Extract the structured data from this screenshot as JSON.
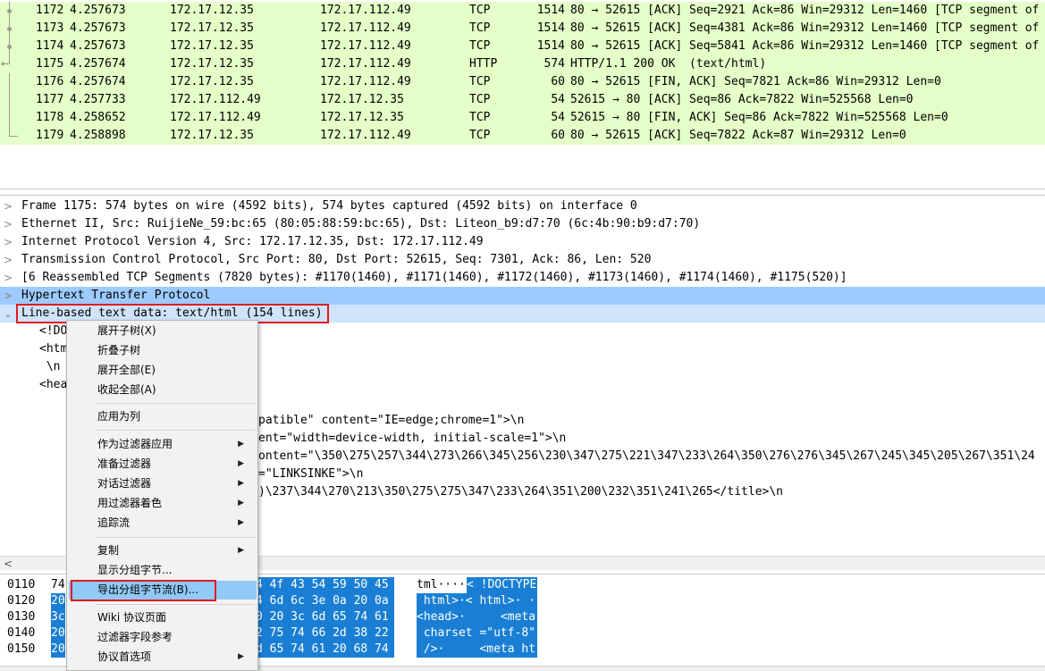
{
  "packet_list": {
    "rows": [
      {
        "no": "1172",
        "time": "4.257673",
        "src": "172.17.12.35",
        "dst": "172.17.112.49",
        "proto": "TCP",
        "len": "1514",
        "info": "80 → 52615 [ACK] Seq=2921 Ack=86 Win=29312 Len=1460 [TCP segment of"
      },
      {
        "no": "1173",
        "time": "4.257673",
        "src": "172.17.12.35",
        "dst": "172.17.112.49",
        "proto": "TCP",
        "len": "1514",
        "info": "80 → 52615 [ACK] Seq=4381 Ack=86 Win=29312 Len=1460 [TCP segment of"
      },
      {
        "no": "1174",
        "time": "4.257673",
        "src": "172.17.12.35",
        "dst": "172.17.112.49",
        "proto": "TCP",
        "len": "1514",
        "info": "80 → 52615 [ACK] Seq=5841 Ack=86 Win=29312 Len=1460 [TCP segment of"
      },
      {
        "no": "1175",
        "time": "4.257674",
        "src": "172.17.12.35",
        "dst": "172.17.112.49",
        "proto": "HTTP",
        "len": "574",
        "info": "HTTP/1.1 200 OK  (text/html)"
      },
      {
        "no": "1176",
        "time": "4.257674",
        "src": "172.17.12.35",
        "dst": "172.17.112.49",
        "proto": "TCP",
        "len": "60",
        "info": "80 → 52615 [FIN, ACK] Seq=7821 Ack=86 Win=29312 Len=0"
      },
      {
        "no": "1177",
        "time": "4.257733",
        "src": "172.17.112.49",
        "dst": "172.17.12.35",
        "proto": "TCP",
        "len": "54",
        "info": "52615 → 80 [ACK] Seq=86 Ack=7822 Win=525568 Len=0"
      },
      {
        "no": "1178",
        "time": "4.258652",
        "src": "172.17.112.49",
        "dst": "172.17.12.35",
        "proto": "TCP",
        "len": "54",
        "info": "52615 → 80 [FIN, ACK] Seq=86 Ack=7822 Win=525568 Len=0"
      },
      {
        "no": "1179",
        "time": "4.258898",
        "src": "172.17.12.35",
        "dst": "172.17.112.49",
        "proto": "TCP",
        "len": "60",
        "info": "80 → 52615 [ACK] Seq=7822 Ack=87 Win=29312 Len=0"
      }
    ]
  },
  "details": {
    "tree": [
      {
        "expander": ">",
        "text": "Frame 1175: 574 bytes on wire (4592 bits), 574 bytes captured (4592 bits) on interface 0"
      },
      {
        "expander": ">",
        "text": "Ethernet II, Src: RuijieNe_59:bc:65 (80:05:88:59:bc:65), Dst: Liteon_b9:d7:70 (6c:4b:90:b9:d7:70)"
      },
      {
        "expander": ">",
        "text": "Internet Protocol Version 4, Src: 172.17.12.35, Dst: 172.17.112.49"
      },
      {
        "expander": ">",
        "text": "Transmission Control Protocol, Src Port: 80, Dst Port: 52615, Seq: 7301, Ack: 86, Len: 520"
      },
      {
        "expander": ">",
        "text": "[6 Reassembled TCP Segments (7820 bytes): #1170(1460), #1171(1460), #1172(1460), #1173(1460), #1174(1460), #1175(520)]"
      },
      {
        "expander": ">",
        "text": "Hypertext Transfer Protocol"
      },
      {
        "expander": "⌄",
        "text": "Line-based text data: text/html (154 lines)"
      }
    ],
    "children_left": [
      "<!DO",
      "<htm",
      " \\n",
      "<hea"
    ],
    "children_right": [
      "patible\" content=\"IE=edge;chrome=1\">\\n",
      "ent=\"width=device-width, initial-scale=1\">\\n",
      "ontent=\"\\350\\275\\257\\344\\273\\266\\345\\256\\230\\347\\275\\221\\347\\233\\264\\350\\276\\276\\345\\267\\245\\345\\205\\267\\351\\24",
      "=\"LINKSINKE\">\\n",
      ")\\237\\344\\270\\213\\350\\275\\275\\347\\233\\264\\351\\200\\232\\351\\241\\265</title>\\n"
    ],
    "scroll_left_glyph": "<"
  },
  "bytes": {
    "rows": [
      {
        "offset": "0110",
        "hex_cut": "74",
        "hex_tail": "4 4f 43 54 59 50 45",
        "ascii_plain": "tml····",
        "ascii_sel": "< !DOCTYPE"
      },
      {
        "offset": "0120",
        "hex_cut": "20",
        "hex_tail": "4 6d 6c 3e 0a 20 0a",
        "ascii_plain": "",
        "ascii_sel": " html>·< html>· ·"
      },
      {
        "offset": "0130",
        "hex_cut": "3c",
        "hex_tail": "0 20 3c 6d 65 74 61",
        "ascii_plain": "",
        "ascii_sel": "<head>·     <meta"
      },
      {
        "offset": "0140",
        "hex_cut": "20",
        "hex_tail": "2 75 74 66 2d 38 22",
        "ascii_plain": "",
        "ascii_sel": " charset =\"utf-8\""
      },
      {
        "offset": "0150",
        "hex_cut": "20",
        "hex_tail": "d 65 74 61 20 68 74",
        "ascii_plain": "",
        "ascii_sel": " />·     <meta ht"
      }
    ]
  },
  "context_menu": {
    "items": [
      {
        "label": "展开子树(X)",
        "submenu": false
      },
      {
        "label": "折叠子树",
        "submenu": false
      },
      {
        "label": "展开全部(E)",
        "submenu": false
      },
      {
        "label": "收起全部(A)",
        "submenu": false
      },
      {
        "label": "应用为列",
        "submenu": false
      },
      {
        "label": "作为过滤器应用",
        "submenu": true
      },
      {
        "label": "准备过滤器",
        "submenu": true
      },
      {
        "label": "对话过滤器",
        "submenu": true
      },
      {
        "label": "用过滤器着色",
        "submenu": true
      },
      {
        "label": "追踪流",
        "submenu": true
      },
      {
        "label": "复制",
        "submenu": true
      },
      {
        "label": "显示分组字节...",
        "submenu": false
      },
      {
        "label": "导出分组字节流(B)...",
        "submenu": false
      },
      {
        "label": "Wiki 协议页面",
        "submenu": false
      },
      {
        "label": "过滤器字段参考",
        "submenu": false
      },
      {
        "label": "协议首选项",
        "submenu": true
      }
    ],
    "submenu_glyph": "▶"
  },
  "colors": {
    "tcp_row_bg": "#e4ffc7",
    "selected_row_bg": "#9ecbff",
    "highlight_box": "#e01a22",
    "menu_hover": "#91c9f7",
    "byte_selection": "#1a7fd4"
  }
}
